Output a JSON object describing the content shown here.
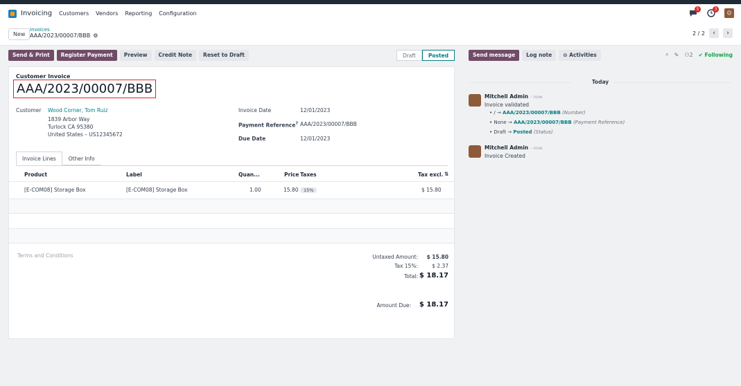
{
  "navbar": {
    "app_name": "Invoicing",
    "menu": [
      "Customers",
      "Vendors",
      "Reporting",
      "Configuration"
    ],
    "badges": {
      "messages": "5",
      "activities": "3"
    }
  },
  "controlbar": {
    "new_label": "New",
    "breadcrumb_parent": "Invoices",
    "breadcrumb_current": "AAA/2023/00007/BBB",
    "pager": "2 / 2"
  },
  "actions": {
    "send_print": "Send & Print",
    "register_payment": "Register Payment",
    "preview": "Preview",
    "credit_note": "Credit Note",
    "reset_to_draft": "Reset to Draft"
  },
  "status": {
    "draft": "Draft",
    "posted": "Posted",
    "active": "posted"
  },
  "invoice": {
    "doc_type": "Customer Invoice",
    "number": "AAA/2023/00007/BBB",
    "customer_label": "Customer",
    "customer_name": "Wood Corner, Tom Ruiz",
    "address1": "1839 Arbor Way",
    "address2": "Turlock CA 95380",
    "address3": "United States – US12345672",
    "invoice_date_label": "Invoice Date",
    "invoice_date": "12/01/2023",
    "payment_ref_label": "Payment Reference",
    "payment_ref": "AAA/2023/00007/BBB",
    "due_date_label": "Due Date",
    "due_date": "12/01/2023"
  },
  "tabs": [
    "Invoice Lines",
    "Other Info"
  ],
  "lines": {
    "headers": {
      "product": "Product",
      "label": "Label",
      "quantity": "Quan...",
      "price": "Price",
      "taxes": "Taxes",
      "tax_excl": "Tax excl."
    },
    "rows": [
      {
        "product": "[E-COM08] Storage Box",
        "label": "[E-COM08] Storage Box",
        "quantity": "1.00",
        "price": "15.80",
        "tax": "15%",
        "subtotal": "$ 15.80"
      }
    ]
  },
  "terms_placeholder": "Terms and Conditions",
  "totals": {
    "untaxed_label": "Untaxed Amount:",
    "untaxed": "$ 15.80",
    "tax_label": "Tax 15%:",
    "tax": "$ 2.37",
    "total_label": "Total:",
    "total": "$ 18.17",
    "due_label": "Amount Due:",
    "due": "$ 18.17"
  },
  "chatter": {
    "send_message": "Send message",
    "log_note": "Log note",
    "activities": "Activities",
    "followers": "2",
    "following": "Following",
    "today": "Today",
    "messages": [
      {
        "author": "Mitchell Admin",
        "time": "- now",
        "text": "Invoice validated",
        "tracking": [
          {
            "old": "/",
            "new": "AAA/2023/00007/BBB",
            "field": "(Number)"
          },
          {
            "old": "None",
            "new": "AAA/2023/00007/BBB",
            "field": "(Payment Reference)"
          },
          {
            "old": "Draft",
            "new": "Posted",
            "field": "(Status)"
          }
        ]
      },
      {
        "author": "Mitchell Admin",
        "time": "- now",
        "text": "Invoice Created"
      }
    ]
  },
  "colors": {
    "primary": "#714b67",
    "link": "#017e84",
    "highlight_box": "#dc2626"
  }
}
